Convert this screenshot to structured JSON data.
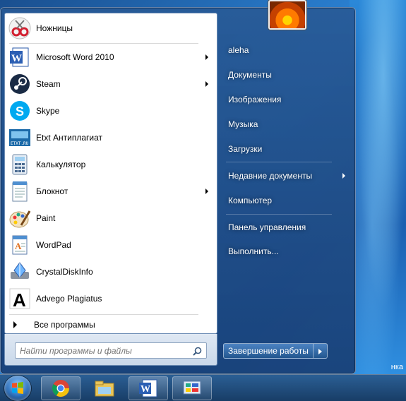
{
  "programs": [
    {
      "label": "Ножницы",
      "icon": "scissors-icon",
      "arrow": false
    },
    {
      "label": "Microsoft Word 2010",
      "icon": "word-icon",
      "arrow": true
    },
    {
      "label": "Steam",
      "icon": "steam-icon",
      "arrow": true
    },
    {
      "label": "Skype",
      "icon": "skype-icon",
      "arrow": false
    },
    {
      "label": "Etxt Антиплагиат",
      "icon": "etxt-icon",
      "icon_text": "ETXT.RU",
      "arrow": false
    },
    {
      "label": "Калькулятор",
      "icon": "calculator-icon",
      "arrow": false
    },
    {
      "label": "Блокнот",
      "icon": "notepad-icon",
      "arrow": true
    },
    {
      "label": "Paint",
      "icon": "paint-icon",
      "arrow": false
    },
    {
      "label": "WordPad",
      "icon": "wordpad-icon",
      "arrow": false
    },
    {
      "label": "CrystalDiskInfo",
      "icon": "crystaldiskinfo-icon",
      "arrow": false
    },
    {
      "label": "Advego Plagiatus",
      "icon": "advego-icon",
      "arrow": false
    }
  ],
  "all_programs_label": "Все программы",
  "search": {
    "placeholder": "Найти программы и файлы"
  },
  "right_pane": [
    {
      "label": "aleha"
    },
    {
      "label": "Документы"
    },
    {
      "label": "Изображения"
    },
    {
      "label": "Музыка"
    },
    {
      "label": "Загрузки"
    },
    {
      "label": "Недавние документы",
      "arrow": true
    },
    {
      "label": "Компьютер"
    },
    {
      "label": "Панель управления"
    },
    {
      "label": "Выполнить..."
    }
  ],
  "shutdown_label": "Завершение работы",
  "desktop_text": "нка",
  "taskbar": [
    "chrome-icon",
    "explorer-icon",
    "word-icon",
    "control-panel-icon"
  ]
}
